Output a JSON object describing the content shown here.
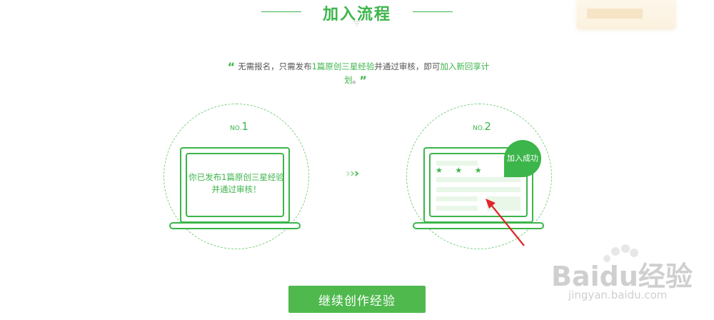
{
  "header": {
    "title": "加入流程"
  },
  "intro": {
    "open_quote": "“",
    "part1": "无需报名，只需发布",
    "highlight1": "1篇原创三星经验",
    "part2": "并通过审核，即可",
    "highlight2": "加入新回享计划",
    "part3": "。",
    "close_quote": "”"
  },
  "step1": {
    "no_prefix": "NO.",
    "no_number": "1",
    "text_line1": "你已发布1篇原创三星经验",
    "text_line2": "并通过审核！"
  },
  "step2": {
    "no_prefix": "NO.",
    "no_number": "2",
    "badge": "加入成功",
    "stars": "★ ★ ★"
  },
  "arrows": [
    "›",
    "›",
    "›"
  ],
  "cta": {
    "label": "继续创作经验"
  },
  "watermark": {
    "brand": "Baidu经验",
    "url": "jingyan.baidu.com"
  },
  "icons": [
    "down-triangle-icon",
    "arrow-right-icon",
    "red-pointer-arrow-icon",
    "baidu-paw-icon"
  ],
  "colors": {
    "accent": "#3cb54a",
    "button": "#4fb94e",
    "pointer": "#e0262a"
  }
}
